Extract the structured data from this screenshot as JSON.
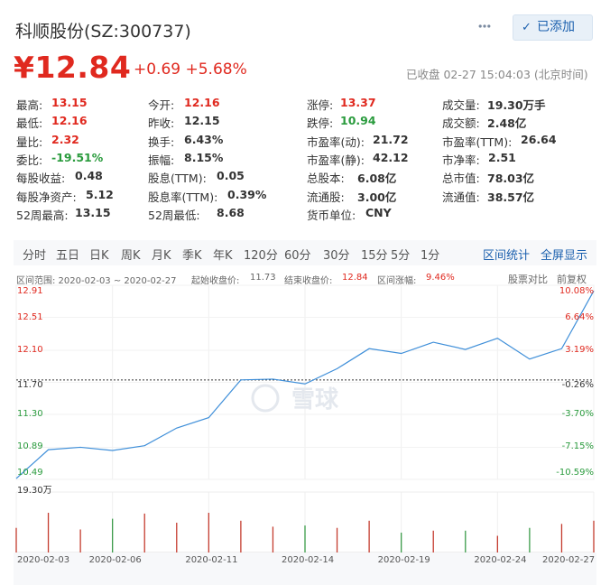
{
  "header": {
    "title": "科顺股份(SZ:300737)",
    "follow_label": "已添加",
    "price": "¥12.84",
    "change": "+0.69 +5.68%",
    "status": "已收盘 02-27 15:04:03 (北京时间)"
  },
  "quote_table": {
    "col1": [
      {
        "label": "最高:",
        "value": "13.15"
      },
      {
        "label": "最低:",
        "value": "12.16"
      },
      {
        "label": "量比:",
        "value": "2.32"
      },
      {
        "label": "委比:",
        "value": "-19.51%"
      },
      {
        "label": "每股收益:",
        "value": "0.48"
      },
      {
        "label": "每股净资产:",
        "value": "5.12"
      },
      {
        "label": "52周最高:",
        "value": "13.15"
      }
    ],
    "col2": [
      {
        "label": "今开:",
        "value": "12.16"
      },
      {
        "label": "昨收:",
        "value": "12.15"
      },
      {
        "label": "换手:",
        "value": "6.43%"
      },
      {
        "label": "振幅:",
        "value": "8.15%"
      },
      {
        "label": "股息(TTM):",
        "value": "0.05"
      },
      {
        "label": "股息率(TTM):",
        "value": "0.39%"
      },
      {
        "label": "52周最低:",
        "value": "8.68"
      }
    ],
    "col3": [
      {
        "label": "涨停:",
        "value": "13.37"
      },
      {
        "label": "跌停:",
        "value": "10.94"
      },
      {
        "label": "市盈率(动):",
        "value": "21.72"
      },
      {
        "label": "市盈率(静):",
        "value": "42.12"
      },
      {
        "label": "总股本:",
        "value": "6.08亿"
      },
      {
        "label": "流通股:",
        "value": "3.00亿"
      },
      {
        "label": "货币单位:",
        "value": "CNY"
      }
    ],
    "col4": [
      {
        "label": "成交量:",
        "value": "19.30万手"
      },
      {
        "label": "成交额:",
        "value": "2.48亿"
      },
      {
        "label": "市盈率(TTM):",
        "value": "26.64"
      },
      {
        "label": "市净率:",
        "value": "2.51"
      },
      {
        "label": "总市值:",
        "value": "78.03亿"
      },
      {
        "label": "流通值:",
        "value": "38.57亿"
      }
    ]
  },
  "chart_tabs": [
    "分时",
    "五日",
    "日K",
    "周K",
    "月K",
    "季K",
    "年K",
    "120分",
    "60分",
    "30分",
    "15分",
    "5分",
    "1分"
  ],
  "chart_actions": {
    "range_stats": "区间统计",
    "fullscreen": "全屏显示"
  },
  "range_info": {
    "range": "区间范围: 2020-02-03 ~ 2020-02-27",
    "start_label": "起始收盘价:",
    "start_value": "11.73",
    "end_label": "结束收盘价:",
    "end_value": "12.84",
    "chg_label": "区间涨幅:",
    "chg_value": "9.46%",
    "compare": "股票对比",
    "adjust": "前复权"
  },
  "watermark": "雪球",
  "chart_data": {
    "type": "line",
    "x": [
      "2020-02-03",
      "2020-02-04",
      "2020-02-05",
      "2020-02-06",
      "2020-02-07",
      "2020-02-10",
      "2020-02-11",
      "2020-02-12",
      "2020-02-13",
      "2020-02-14",
      "2020-02-17",
      "2020-02-18",
      "2020-02-19",
      "2020-02-20",
      "2020-02-21",
      "2020-02-24",
      "2020-02-25",
      "2020-02-26",
      "2020-02-27"
    ],
    "values": [
      10.5,
      10.86,
      10.89,
      10.85,
      10.91,
      11.13,
      11.26,
      11.73,
      11.74,
      11.68,
      11.87,
      12.12,
      12.06,
      12.2,
      12.11,
      12.25,
      11.99,
      12.12,
      12.84
    ],
    "volume_peak_label": "19.30万",
    "volume": [
      0.62,
      1.0,
      0.58,
      0.85,
      0.98,
      0.75,
      1.0,
      0.8,
      0.65,
      0.68,
      0.62,
      0.8,
      0.5,
      0.55,
      0.55,
      0.42,
      0.62,
      0.72,
      0.8
    ],
    "volume_colors": [
      "#c43b2e",
      "#c43b2e",
      "#c43b2e",
      "#3a9b49",
      "#c43b2e",
      "#c43b2e",
      "#c43b2e",
      "#c43b2e",
      "#c43b2e",
      "#3a9b49",
      "#c43b2e",
      "#c43b2e",
      "#3a9b49",
      "#c43b2e",
      "#3a9b49",
      "#c43b2e",
      "#3a9b49",
      "#c43b2e",
      "#c43b2e"
    ],
    "ylim": [
      10.49,
      12.91
    ],
    "yticks": [
      "12.91",
      "12.51",
      "12.10",
      "11.70",
      "11.30",
      "10.89",
      "10.49"
    ],
    "pct_ticks": [
      "10.08%",
      "6.64%",
      "3.19%",
      "-0.26%",
      "-3.70%",
      "-7.15%",
      "-10.59%"
    ],
    "xtick_labels": [
      "2020-02-03",
      "2020-02-06",
      "2020-02-11",
      "2020-02-14",
      "2020-02-19",
      "2020-02-24",
      "2020-02-27"
    ],
    "base_price": 11.73,
    "line_color": "#3f8fd9"
  }
}
